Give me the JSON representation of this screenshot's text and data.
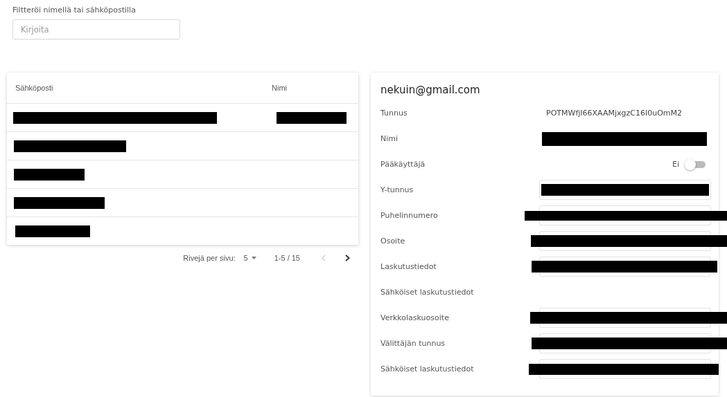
{
  "filter": {
    "label": "Filtteröi nimellä tai sähköpostilla",
    "placeholder": "Kirjoita"
  },
  "table": {
    "columns": [
      "Sähköposti",
      "Nimi"
    ],
    "rows": [
      {
        "email_redacted": true,
        "name_redacted": true
      },
      {
        "email_redacted": true
      },
      {
        "email_redacted": true
      },
      {
        "email_redacted": true
      },
      {
        "email_redacted": true
      }
    ]
  },
  "pagination": {
    "rows_per_page_label": "Rivejä per sivu:",
    "rows_per_page": "5",
    "range": "1-5 / 15",
    "prev_disabled": true,
    "next_disabled": false
  },
  "detail": {
    "title": "nekuin@gmail.com",
    "fields": [
      {
        "kind": "text",
        "label": "Tunnus",
        "value": "POTMWfjI66XAAMjxgzC16I0uOmM2"
      },
      {
        "kind": "text",
        "label": "Nimi",
        "redacted": true
      },
      {
        "kind": "switch",
        "label": "Pääkäyttäjä",
        "value": "Ei",
        "on": false
      },
      {
        "kind": "input",
        "label": "Y-tunnus",
        "redacted": true
      },
      {
        "kind": "input",
        "label": "Puhelinnumero",
        "redacted": true
      },
      {
        "kind": "input",
        "label": "Osoite",
        "redacted": true
      },
      {
        "kind": "input",
        "label": "Laskutustiedot",
        "redacted": true
      },
      {
        "kind": "section",
        "label": "Sähköiset laskutustiedot"
      },
      {
        "kind": "input",
        "label": "Verkkolaskuosoite",
        "redacted": true
      },
      {
        "kind": "input",
        "label": "Välittäjän tunnus",
        "redacted": true
      },
      {
        "kind": "input",
        "label": "Sähköiset laskutustiedot",
        "redacted": true
      }
    ]
  }
}
